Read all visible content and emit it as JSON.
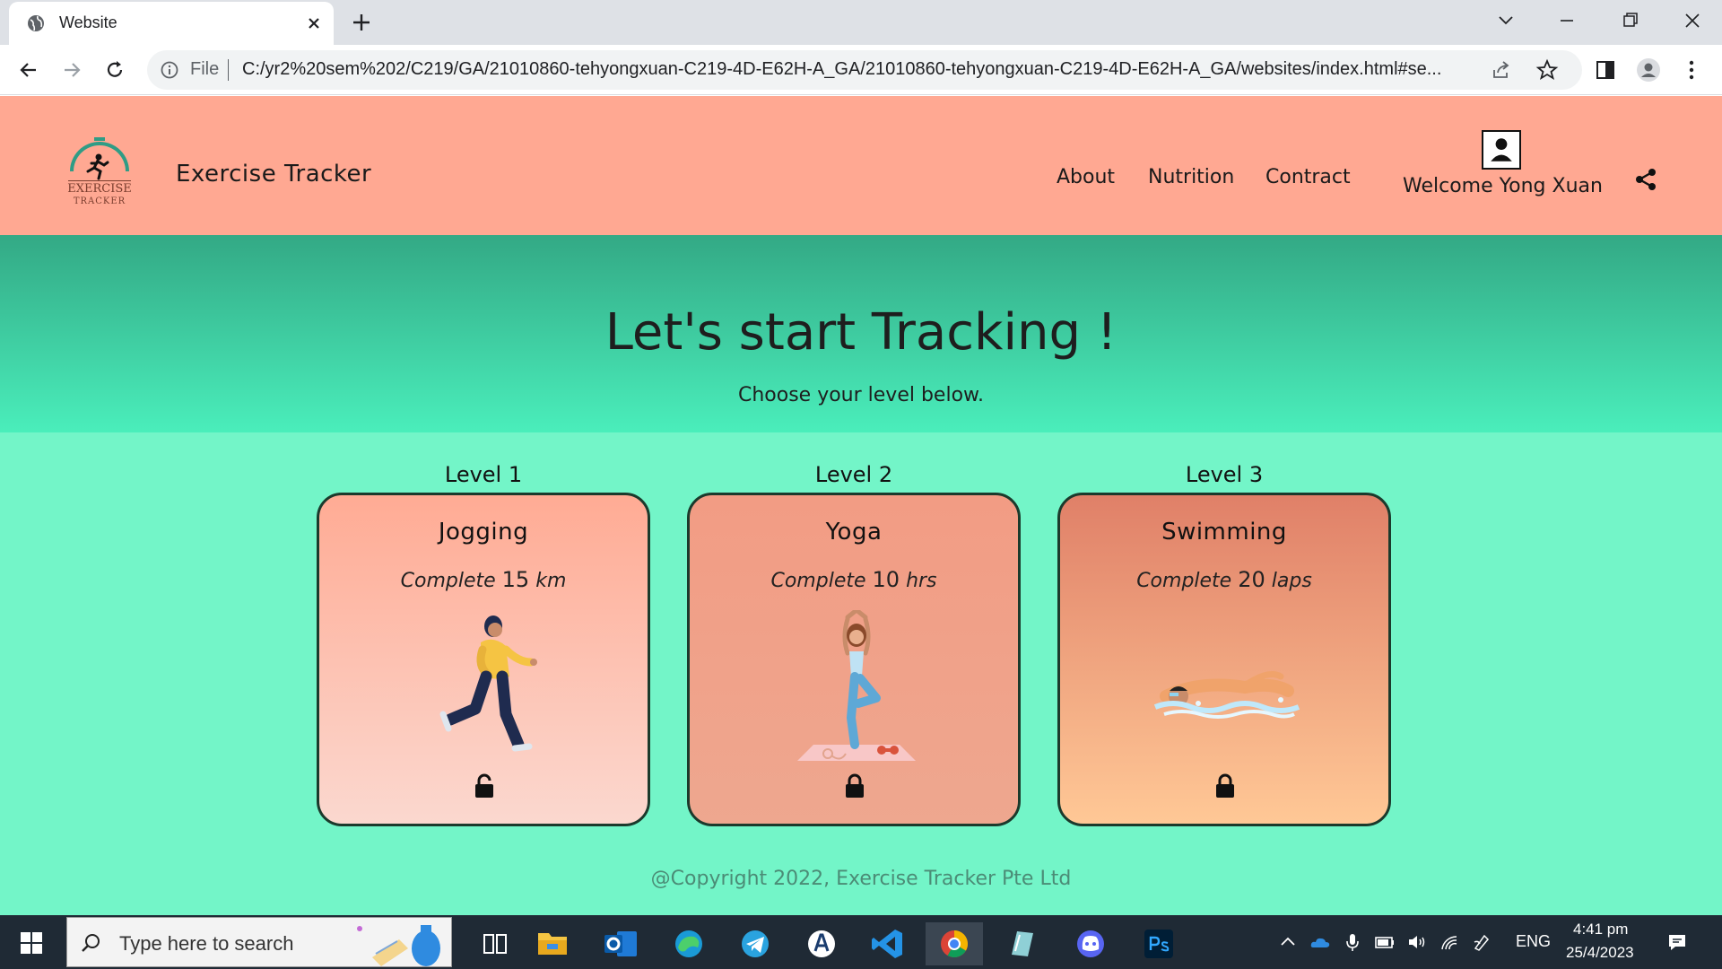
{
  "browser": {
    "tab_title": "Website",
    "omnibox_scheme": "File",
    "url": "C:/yr2%20sem%202/C219/GA/21010860-tehyongxuan-C219-4D-E62H-A_GA/21010860-tehyongxuan-C219-4D-E62H-A_GA/websites/index.html#se..."
  },
  "site": {
    "logo_text_top": "EXERCISE",
    "logo_text_bottom": "TRACKER",
    "brand": "Exercise Tracker",
    "nav": [
      "About",
      "Nutrition",
      "Contract"
    ],
    "welcome": "Welcome Yong Xuan",
    "accent_header": "#ffa892",
    "accent_page": "#73f5c8"
  },
  "hero": {
    "title": "Let's start Tracking !",
    "subtitle": "Choose your level below."
  },
  "levels": [
    {
      "label": "Level 1",
      "title": "Jogging",
      "task_prefix": "Complete",
      "task_value": "15",
      "task_unit": "km",
      "illustration": "jogging-person",
      "lock_state": "unlocked"
    },
    {
      "label": "Level 2",
      "title": "Yoga",
      "task_prefix": "Complete",
      "task_value": "10",
      "task_unit": "hrs",
      "illustration": "yoga-person",
      "lock_state": "locked"
    },
    {
      "label": "Level 3",
      "title": "Swimming",
      "task_prefix": "Complete",
      "task_value": "20",
      "task_unit": "laps",
      "illustration": "swimmer",
      "lock_state": "locked"
    }
  ],
  "footer": {
    "copyright": "@Copyright 2022, Exercise Tracker Pte Ltd"
  },
  "taskbar": {
    "search_placeholder": "Type here to search",
    "language": "ENG",
    "time": "4:41 pm",
    "date": "25/4/2023"
  }
}
